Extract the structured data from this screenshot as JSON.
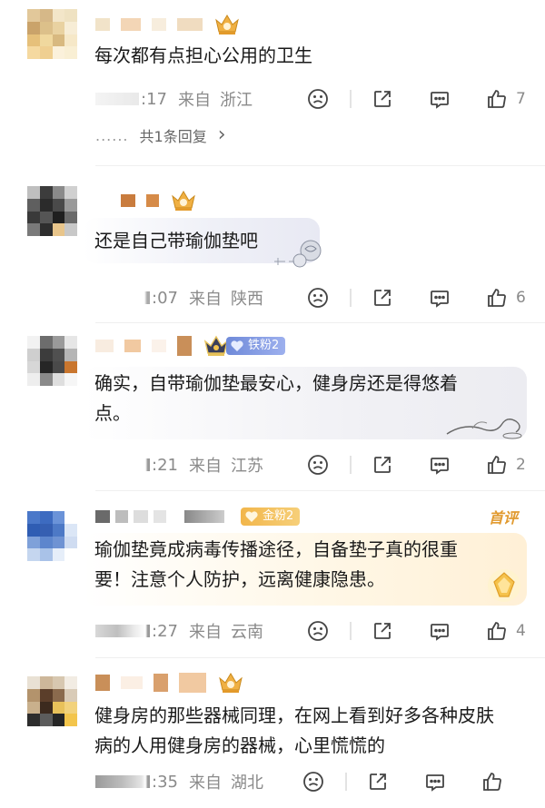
{
  "comments": [
    {
      "text": "每次都有点担心公用的卫生",
      "time": ":17",
      "source": "来自",
      "location": "浙江",
      "like_count": "7",
      "reply_summary": "共1条回复",
      "reply_dots": "......",
      "reply_chevron": "›"
    },
    {
      "text": "还是自己带瑜伽垫吧",
      "time": ":07",
      "source": "来自",
      "location": "陕西",
      "like_count": "6"
    },
    {
      "text": "确实，自带瑜伽垫最安心，健身房还是得悠着\n点。",
      "time": ":21",
      "source": "来自",
      "location": "江苏",
      "like_count": "2",
      "badge": "铁粉2"
    },
    {
      "text": "瑜伽垫竟成病毒传播途径，自备垫子真的很重\n要！注意个人防护，远离健康隐患。",
      "time": ":27",
      "source": "来自",
      "location": "云南",
      "like_count": "4",
      "badge": "金粉2",
      "tag": "首评"
    },
    {
      "text": "健身房的那些器械同理，在网上看到好多各种皮肤\n病的人用健身房的器械，心里慌慌的",
      "time": ":35",
      "source": "来自",
      "location": "湖北",
      "like_count": ""
    }
  ],
  "icons": {
    "dislike": "frown-face-icon",
    "share": "share-icon",
    "reply": "comment-bubble-icon",
    "like": "thumbs-up-icon",
    "crown": "crown-badge-icon"
  },
  "colors": {
    "meta_text": "#8a8a8a",
    "iron_badge": "#7b93de",
    "gold_badge": "#f2b64b",
    "first_comment_tag": "#e19a2f"
  }
}
